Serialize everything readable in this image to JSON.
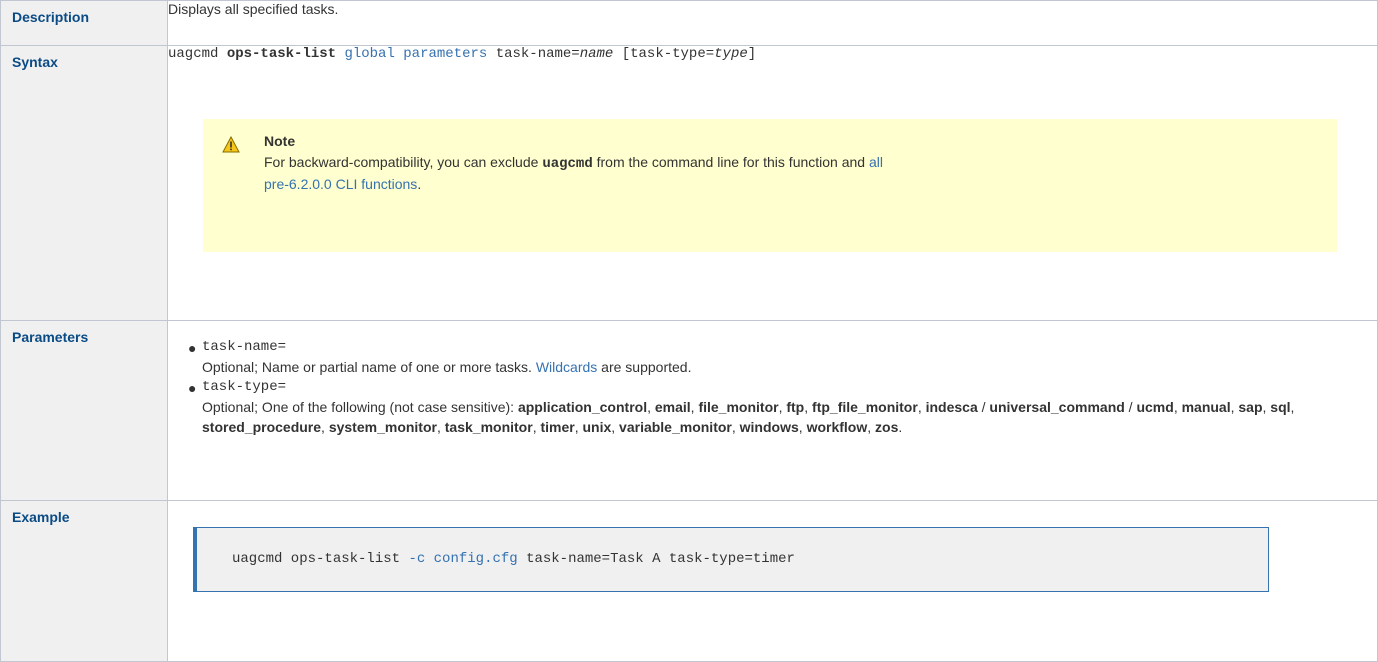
{
  "rows": {
    "description": {
      "label": "Description",
      "text": "Displays all specified tasks."
    },
    "syntax": {
      "label": "Syntax",
      "cmd": "uagcmd",
      "subcommand": "ops-task-list",
      "global": "global parameters",
      "taskname_key": "task-name=",
      "taskname_val": "name",
      "tasktype_prefix": "[task-type=",
      "tasktype_val": "type",
      "tasktype_suffix": "]",
      "note": {
        "icon": "warning-icon",
        "title": "Note",
        "text_before": "For backward-compatibility, you can exclude ",
        "code": "uagcmd",
        "text_middle": " from the command line for this function and ",
        "link_line1": "all",
        "link_line2": "pre-6.2.0.0 CLI functions",
        "text_after": "."
      }
    },
    "parameters": {
      "label": "Parameters",
      "items": [
        {
          "name": "task-name=",
          "desc_before": "Optional; Name or partial name of one or more tasks. ",
          "link": "Wildcards",
          "desc_after": " are supported."
        },
        {
          "name": "task-type=",
          "desc_intro": "Optional; One of the following (not case sensitive): ",
          "types": [
            "application_control",
            "email",
            "file_monitor",
            "ftp",
            "ftp_file_monitor",
            "indesca",
            "universal_command",
            "ucmd",
            "manual",
            "sap",
            "sql",
            "stored_procedure",
            "system_monitor",
            "task_monitor",
            "timer",
            "unix",
            "variable_monitor",
            "windows",
            "workflow",
            "zos"
          ]
        }
      ]
    },
    "example": {
      "label": "Example",
      "cmd_before": "uagcmd ops-task-list ",
      "flag": "-c",
      "file": "config.cfg",
      "cmd_after": " task-name=Task A task-type=timer"
    }
  },
  "colors": {
    "header_text": "#0a4b85",
    "header_bg": "#f0f0f0",
    "link": "#3572b0",
    "note_bg": "#ffffcf",
    "code_border": "#3572b0"
  }
}
